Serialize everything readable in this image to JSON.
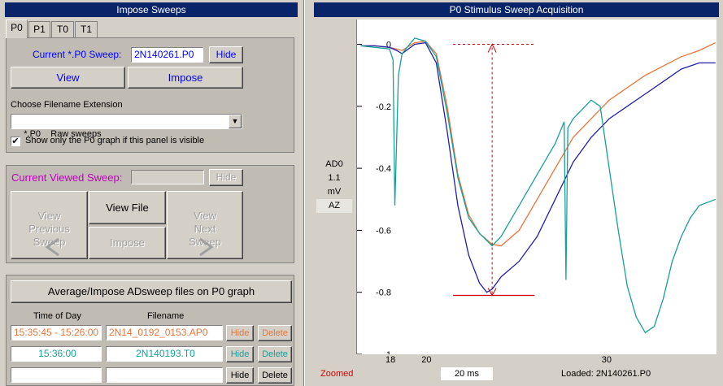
{
  "left_panel": {
    "title": "Impose Sweeps",
    "tabs": [
      "P0",
      "P1",
      "T0",
      "T1"
    ],
    "current": {
      "label": "Current *.P0 Sweep:",
      "value": "2N140261.P0",
      "hide_label": "Hide",
      "view_label": "View",
      "impose_label": "Impose",
      "ext_label": "Choose Filename Extension",
      "ext_value": "*.P0    Raw sweeps",
      "checkbox_label": "Show only the P0 graph if this panel is visible",
      "checkbox_checked": true
    },
    "viewed": {
      "label": "Current Viewed Sweep:",
      "value": "",
      "hide_label": "Hide",
      "prev_label": "View\nPrevious\nSweep",
      "view_file_label": "View File",
      "impose_label": "Impose",
      "next_label": "View\nNext\nSweep"
    },
    "average": {
      "button_label": "Average/Impose ADsweep files on P0 graph",
      "col_time": "Time of Day",
      "col_filename": "Filename",
      "rows": [
        {
          "time": "15:35:45 - 15:26:00",
          "filename": "2N14_0192_0153.AP0",
          "hide": "Hide",
          "delete": "Delete",
          "color": "#e8743a"
        },
        {
          "time": "15:36:00",
          "filename": "2N140193.T0",
          "hide": "Hide",
          "delete": "Delete",
          "color": "#18a09a"
        },
        {
          "time": "",
          "filename": "",
          "hide": "Hide",
          "delete": "Delete",
          "color": "#000000"
        }
      ]
    }
  },
  "right_panel": {
    "title": "P0 Stimulus Sweep Acquisition",
    "channel": {
      "name": "AD0",
      "gain": "1.1",
      "unit": "mV",
      "mode": "AZ"
    },
    "status": {
      "zoomed": "Zoomed",
      "timebase": "20 ms",
      "loaded": "Loaded: 2N140261.P0"
    }
  },
  "chart_data": {
    "type": "line",
    "x_ticks": [
      "18",
      "20",
      "30"
    ],
    "y_ticks": [
      "0",
      "-0.2",
      "-0.4",
      "-0.6",
      "-0.8",
      "-1"
    ],
    "xlim": [
      18,
      38
    ],
    "ylim": [
      -1.0,
      0.08
    ],
    "grid": false,
    "series": [
      {
        "color": "#e8743a",
        "x": [
          18.2,
          19,
          19.8,
          20.5,
          21.2,
          21.8,
          22.4,
          23.0,
          23.6,
          24.2,
          24.8,
          25.5,
          26.0,
          27.0,
          28.0,
          29.0,
          30.0,
          31.0,
          32.0,
          33.0,
          34.0,
          35.0,
          36.0,
          37.0,
          37.9
        ],
        "y": [
          -0.005,
          -0.005,
          -0.01,
          -0.02,
          0.005,
          0.01,
          -0.03,
          -0.2,
          -0.42,
          -0.55,
          -0.61,
          -0.645,
          -0.65,
          -0.6,
          -0.5,
          -0.4,
          -0.3,
          -0.24,
          -0.18,
          -0.14,
          -0.1,
          -0.07,
          -0.04,
          -0.02,
          0.005
        ]
      },
      {
        "color": "#2020a8",
        "x": [
          18.2,
          19,
          19.8,
          20.2,
          20.5,
          21.2,
          21.8,
          22.4,
          23.0,
          23.6,
          24.2,
          24.8,
          25.2,
          25.5,
          26.0,
          27.0,
          28.0,
          29.0,
          30.0,
          31.0,
          32.0,
          33.0,
          34.0,
          35.0,
          36.0,
          37.0,
          37.9
        ],
        "y": [
          -0.005,
          -0.005,
          -0.01,
          -0.02,
          -0.03,
          0.0,
          0.005,
          -0.06,
          -0.28,
          -0.52,
          -0.68,
          -0.77,
          -0.8,
          -0.79,
          -0.75,
          -0.7,
          -0.62,
          -0.5,
          -0.38,
          -0.3,
          -0.24,
          -0.2,
          -0.16,
          -0.12,
          -0.08,
          -0.06,
          -0.06
        ]
      },
      {
        "color": "#18a09a",
        "x": [
          18.2,
          19,
          19.8,
          20.0,
          20.1,
          20.3,
          20.5,
          21.2,
          21.8,
          22.4,
          23.0,
          23.6,
          24.2,
          24.8,
          25.5,
          26.0,
          27.0,
          28.0,
          29.0,
          29.5,
          29.6,
          29.7,
          30.0,
          31.0,
          31.5,
          32.0,
          32.5,
          33.0,
          33.5,
          34.0,
          34.5,
          35.0,
          35.5,
          36.0,
          36.5,
          37.0,
          37.9
        ],
        "y": [
          -0.005,
          -0.01,
          -0.015,
          -0.05,
          -0.52,
          -0.1,
          -0.03,
          0.02,
          0.01,
          -0.04,
          -0.22,
          -0.43,
          -0.56,
          -0.61,
          -0.65,
          -0.62,
          -0.52,
          -0.42,
          -0.32,
          -0.25,
          -0.76,
          -0.27,
          -0.24,
          -0.18,
          -0.2,
          -0.4,
          -0.6,
          -0.78,
          -0.88,
          -0.93,
          -0.91,
          -0.82,
          -0.7,
          -0.62,
          -0.56,
          -0.52,
          -0.5
        ]
      }
    ],
    "annotation": {
      "x": 25.5,
      "peak_y": -0.81,
      "baseline_y": 0.0
    }
  }
}
